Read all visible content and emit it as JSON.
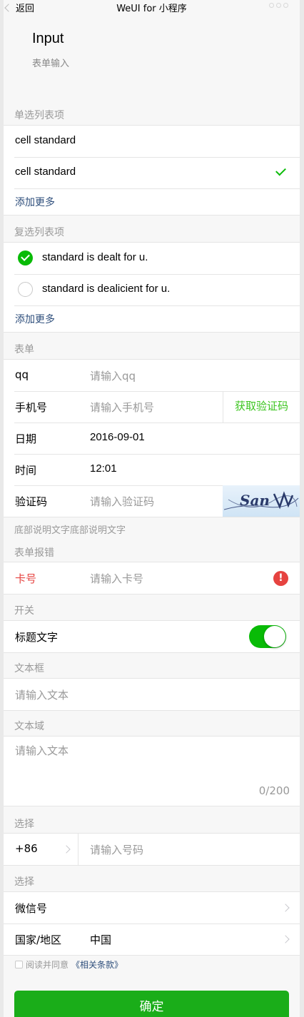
{
  "nav": {
    "back_label": "返回",
    "title": "WeUI for 小程序"
  },
  "header": {
    "title": "Input",
    "desc": "表单输入"
  },
  "radio_section": {
    "title": "单选列表项",
    "items": [
      {
        "label": "cell standard"
      },
      {
        "label": "cell standard",
        "checked": true
      }
    ],
    "add_more": "添加更多"
  },
  "checkbox_section": {
    "title": "复选列表项",
    "items": [
      {
        "label": "standard is dealt for u.",
        "checked": true
      },
      {
        "label": "standard is dealicient for u.",
        "checked": false
      }
    ],
    "add_more": "添加更多"
  },
  "form_section": {
    "title": "表单",
    "qq": {
      "label": "qq",
      "placeholder": "请输入qq"
    },
    "phone": {
      "label": "手机号",
      "placeholder": "请输入手机号",
      "vcode_button": "获取验证码"
    },
    "date": {
      "label": "日期",
      "value": "2016-09-01"
    },
    "time": {
      "label": "时间",
      "value": "12:01"
    },
    "vcode": {
      "label": "验证码",
      "placeholder": "请输入验证码",
      "captcha_text": "San"
    },
    "footer_tip": "底部说明文字底部说明文字"
  },
  "error_section": {
    "title": "表单报错",
    "card": {
      "label": "卡号",
      "placeholder": "请输入卡号",
      "icon": "warn-icon",
      "color": "#e64340"
    }
  },
  "switch_section": {
    "title": "开关",
    "label": "标题文字",
    "on": true,
    "color": "#09bb07"
  },
  "textbox_section": {
    "title": "文本框",
    "placeholder": "请输入文本"
  },
  "textarea_section": {
    "title": "文本域",
    "placeholder": "请输入文本",
    "counter": "0/200"
  },
  "select1_section": {
    "title": "选择",
    "code": "+86",
    "placeholder": "请输入号码"
  },
  "select2_section": {
    "title": "选择",
    "wechat_label": "微信号",
    "country": {
      "label": "国家/地区",
      "value": "中国"
    }
  },
  "agreement": {
    "prefix": "阅读并同意",
    "terms": "《相关条款》"
  },
  "confirm_button": "确定",
  "colors": {
    "accent": "#1aad19",
    "link": "#2f4f7c",
    "error": "#e64340"
  }
}
